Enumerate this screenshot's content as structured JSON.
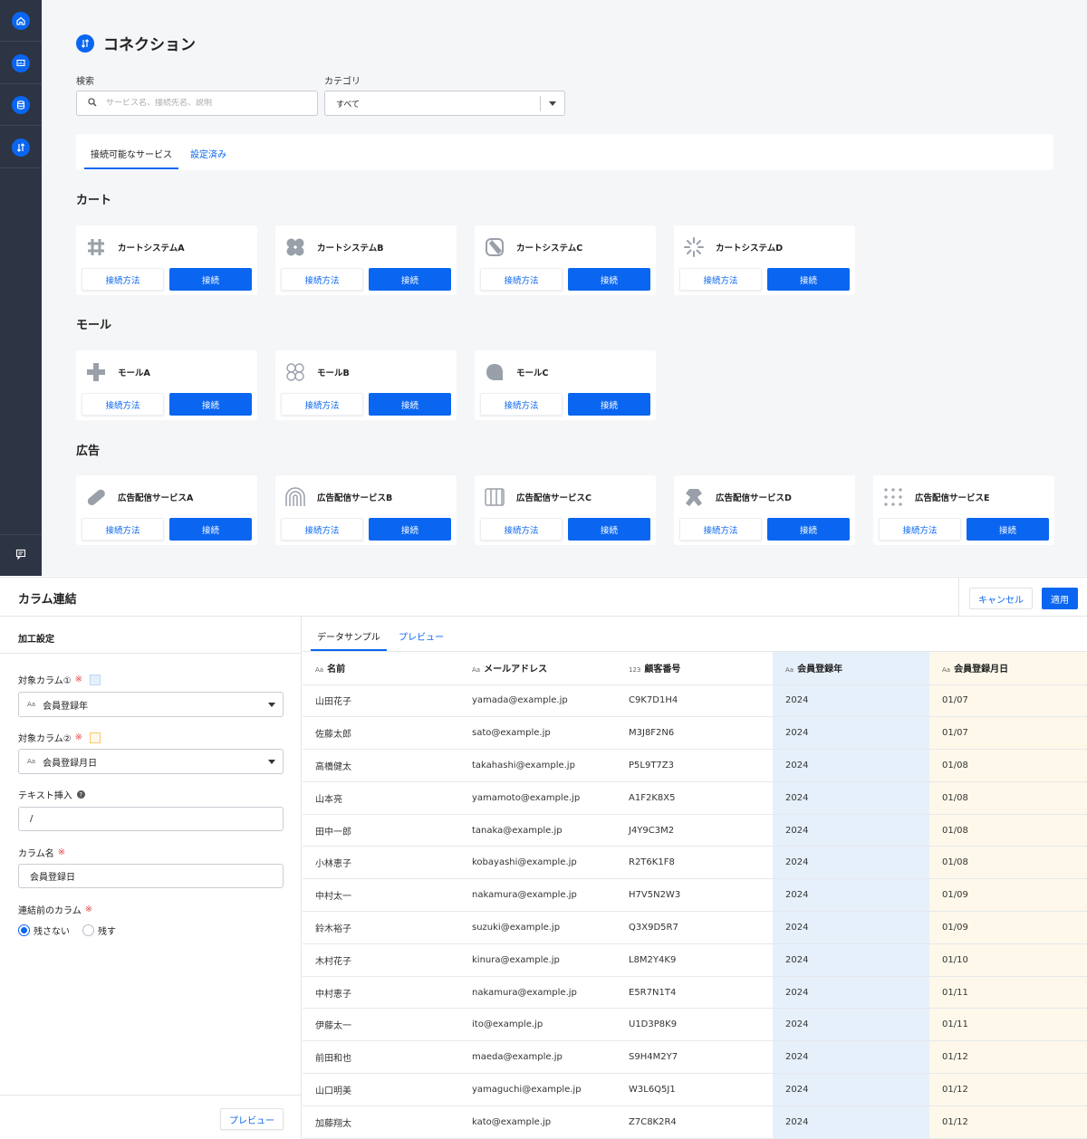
{
  "page": {
    "title": "コネクション",
    "search_label": "検索",
    "search_placeholder": "サービス名、接続先名、説明",
    "category_label": "カテゴリ",
    "category_value": "すべて",
    "tabs": [
      "接続可能なサービス",
      "設定済み"
    ],
    "how_label": "接続方法",
    "connect_label": "接続"
  },
  "sections": [
    {
      "title": "カート",
      "cards": [
        {
          "name": "カートシステムA",
          "icon": "hash-logo-icon"
        },
        {
          "name": "カートシステムB",
          "icon": "clover-logo-icon"
        },
        {
          "name": "カートシステムC",
          "icon": "slash-logo-icon"
        },
        {
          "name": "カートシステムD",
          "icon": "sunburst-logo-icon"
        }
      ]
    },
    {
      "title": "モール",
      "cards": [
        {
          "name": "モールA",
          "icon": "cross-logo-icon"
        },
        {
          "name": "モールB",
          "icon": "rings-logo-icon"
        },
        {
          "name": "モールC",
          "icon": "blob-logo-icon"
        }
      ]
    },
    {
      "title": "広告",
      "cards": [
        {
          "name": "広告配信サービスA",
          "icon": "pill-logo-icon"
        },
        {
          "name": "広告配信サービスB",
          "icon": "arch-logo-icon"
        },
        {
          "name": "広告配信サービスC",
          "icon": "columns-logo-icon"
        },
        {
          "name": "広告配信サービスD",
          "icon": "figure-logo-icon"
        },
        {
          "name": "広告配信サービスE",
          "icon": "dots-logo-icon"
        }
      ]
    }
  ],
  "dialog": {
    "title": "カラム連結",
    "cancel": "キャンセル",
    "apply": "適用",
    "settings_title": "加工設定",
    "col1_label": "対象カラム①",
    "col1_value": "会員登録年",
    "col2_label": "対象カラム②",
    "col2_value": "会員登録月日",
    "text_insert_label": "テキスト挿入",
    "text_insert_value": "/",
    "colname_label": "カラム名",
    "colname_value": "会員登録日",
    "before_label": "連結前のカラム",
    "radio_no": "残さない",
    "radio_yes": "残す",
    "preview_button": "プレビュー",
    "required_mark": "※",
    "type_text": "Aa",
    "type_number": "123",
    "col1_color": "#bcd6f3",
    "col2_color": "#f6c76b",
    "accent": "#0a66f0"
  },
  "table": {
    "tabs": [
      "データサンプル",
      "プレビュー"
    ],
    "headers": [
      {
        "type": "Aa",
        "label": "名前"
      },
      {
        "type": "Aa",
        "label": "メールアドレス"
      },
      {
        "type": "123",
        "label": "顧客番号"
      },
      {
        "type": "Aa",
        "label": "会員登録年"
      },
      {
        "type": "Aa",
        "label": "会員登録月日"
      }
    ],
    "rows": [
      [
        "山田花子",
        "yamada@example.jp",
        "C9K7D1H4",
        "2024",
        "01/07"
      ],
      [
        "佐藤太郎",
        "sato@example.jp",
        "M3J8F2N6",
        "2024",
        "01/07"
      ],
      [
        "高橋健太",
        "takahashi@example.jp",
        "P5L9T7Z3",
        "2024",
        "01/08"
      ],
      [
        "山本亮",
        "yamamoto@example.jp",
        "A1F2K8X5",
        "2024",
        "01/08"
      ],
      [
        "田中一郎",
        "tanaka@example.jp",
        "J4Y9C3M2",
        "2024",
        "01/08"
      ],
      [
        "小林恵子",
        "kobayashi@example.jp",
        "R2T6K1F8",
        "2024",
        "01/08"
      ],
      [
        "中村太一",
        "nakamura@example.jp",
        "H7V5N2W3",
        "2024",
        "01/09"
      ],
      [
        "鈴木裕子",
        "suzuki@example.jp",
        "Q3X9D5R7",
        "2024",
        "01/09"
      ],
      [
        "木村花子",
        "kinura@example.jp",
        "L8M2Y4K9",
        "2024",
        "01/10"
      ],
      [
        "中村恵子",
        "nakamura@example.jp",
        "E5R7N1T4",
        "2024",
        "01/11"
      ],
      [
        "伊藤太一",
        "ito@example.jp",
        "U1D3P8K9",
        "2024",
        "01/11"
      ],
      [
        "前田和也",
        "maeda@example.jp",
        "S9H4M2Y7",
        "2024",
        "01/12"
      ],
      [
        "山口明美",
        "yamaguchi@example.jp",
        "W3L6Q5J1",
        "2024",
        "01/12"
      ],
      [
        "加藤翔太",
        "kato@example.jp",
        "Z7C8K2R4",
        "2024",
        "01/12"
      ]
    ]
  }
}
